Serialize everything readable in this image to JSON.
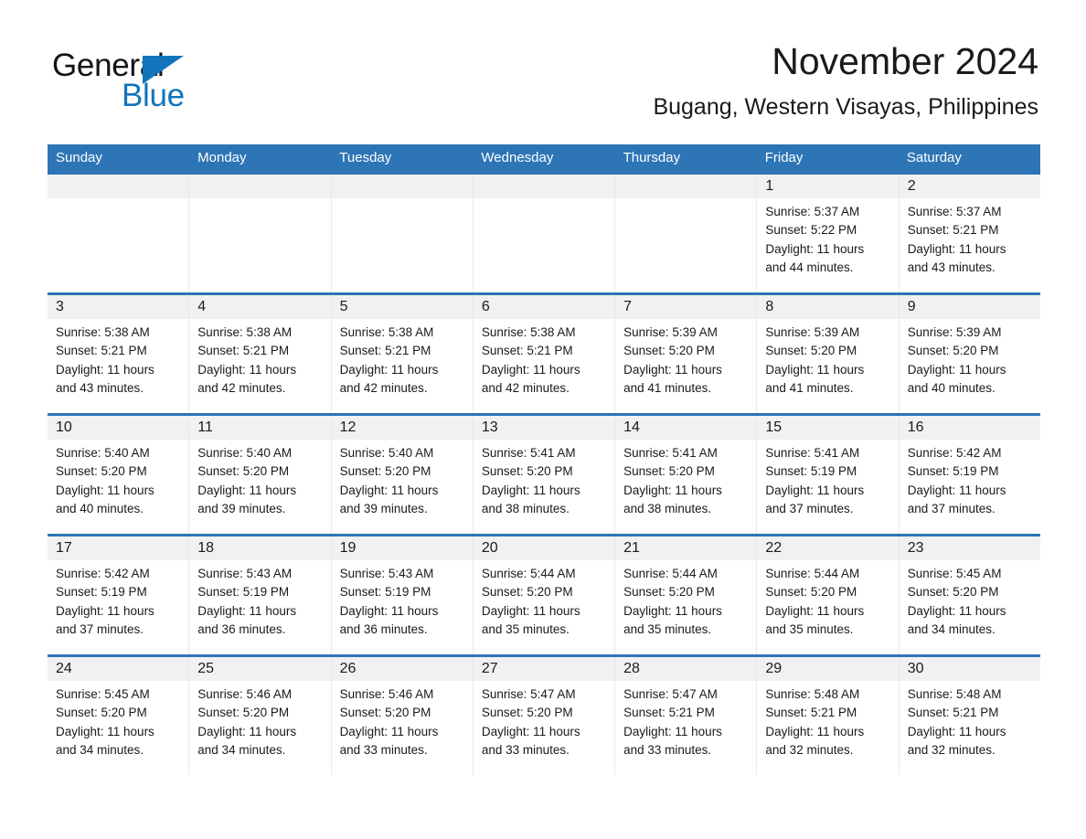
{
  "brand": {
    "name_part1": "General",
    "name_part2": "Blue",
    "triangle_icon": "triangle-icon",
    "color_black": "#141414",
    "color_blue": "#1275bc"
  },
  "header": {
    "title": "November 2024",
    "subtitle": "Bugang, Western Visayas, Philippines"
  },
  "theme": {
    "header_blue": "#2e75b6",
    "day_band_gray": "#f1f1f1",
    "text_color": "#1a1a1a"
  },
  "weekdays": [
    "Sunday",
    "Monday",
    "Tuesday",
    "Wednesday",
    "Thursday",
    "Friday",
    "Saturday"
  ],
  "weeks": [
    [
      {
        "day": "",
        "lines": []
      },
      {
        "day": "",
        "lines": []
      },
      {
        "day": "",
        "lines": []
      },
      {
        "day": "",
        "lines": []
      },
      {
        "day": "",
        "lines": []
      },
      {
        "day": "1",
        "lines": [
          "Sunrise: 5:37 AM",
          "Sunset: 5:22 PM",
          "Daylight: 11 hours",
          "and 44 minutes."
        ]
      },
      {
        "day": "2",
        "lines": [
          "Sunrise: 5:37 AM",
          "Sunset: 5:21 PM",
          "Daylight: 11 hours",
          "and 43 minutes."
        ]
      }
    ],
    [
      {
        "day": "3",
        "lines": [
          "Sunrise: 5:38 AM",
          "Sunset: 5:21 PM",
          "Daylight: 11 hours",
          "and 43 minutes."
        ]
      },
      {
        "day": "4",
        "lines": [
          "Sunrise: 5:38 AM",
          "Sunset: 5:21 PM",
          "Daylight: 11 hours",
          "and 42 minutes."
        ]
      },
      {
        "day": "5",
        "lines": [
          "Sunrise: 5:38 AM",
          "Sunset: 5:21 PM",
          "Daylight: 11 hours",
          "and 42 minutes."
        ]
      },
      {
        "day": "6",
        "lines": [
          "Sunrise: 5:38 AM",
          "Sunset: 5:21 PM",
          "Daylight: 11 hours",
          "and 42 minutes."
        ]
      },
      {
        "day": "7",
        "lines": [
          "Sunrise: 5:39 AM",
          "Sunset: 5:20 PM",
          "Daylight: 11 hours",
          "and 41 minutes."
        ]
      },
      {
        "day": "8",
        "lines": [
          "Sunrise: 5:39 AM",
          "Sunset: 5:20 PM",
          "Daylight: 11 hours",
          "and 41 minutes."
        ]
      },
      {
        "day": "9",
        "lines": [
          "Sunrise: 5:39 AM",
          "Sunset: 5:20 PM",
          "Daylight: 11 hours",
          "and 40 minutes."
        ]
      }
    ],
    [
      {
        "day": "10",
        "lines": [
          "Sunrise: 5:40 AM",
          "Sunset: 5:20 PM",
          "Daylight: 11 hours",
          "and 40 minutes."
        ]
      },
      {
        "day": "11",
        "lines": [
          "Sunrise: 5:40 AM",
          "Sunset: 5:20 PM",
          "Daylight: 11 hours",
          "and 39 minutes."
        ]
      },
      {
        "day": "12",
        "lines": [
          "Sunrise: 5:40 AM",
          "Sunset: 5:20 PM",
          "Daylight: 11 hours",
          "and 39 minutes."
        ]
      },
      {
        "day": "13",
        "lines": [
          "Sunrise: 5:41 AM",
          "Sunset: 5:20 PM",
          "Daylight: 11 hours",
          "and 38 minutes."
        ]
      },
      {
        "day": "14",
        "lines": [
          "Sunrise: 5:41 AM",
          "Sunset: 5:20 PM",
          "Daylight: 11 hours",
          "and 38 minutes."
        ]
      },
      {
        "day": "15",
        "lines": [
          "Sunrise: 5:41 AM",
          "Sunset: 5:19 PM",
          "Daylight: 11 hours",
          "and 37 minutes."
        ]
      },
      {
        "day": "16",
        "lines": [
          "Sunrise: 5:42 AM",
          "Sunset: 5:19 PM",
          "Daylight: 11 hours",
          "and 37 minutes."
        ]
      }
    ],
    [
      {
        "day": "17",
        "lines": [
          "Sunrise: 5:42 AM",
          "Sunset: 5:19 PM",
          "Daylight: 11 hours",
          "and 37 minutes."
        ]
      },
      {
        "day": "18",
        "lines": [
          "Sunrise: 5:43 AM",
          "Sunset: 5:19 PM",
          "Daylight: 11 hours",
          "and 36 minutes."
        ]
      },
      {
        "day": "19",
        "lines": [
          "Sunrise: 5:43 AM",
          "Sunset: 5:19 PM",
          "Daylight: 11 hours",
          "and 36 minutes."
        ]
      },
      {
        "day": "20",
        "lines": [
          "Sunrise: 5:44 AM",
          "Sunset: 5:20 PM",
          "Daylight: 11 hours",
          "and 35 minutes."
        ]
      },
      {
        "day": "21",
        "lines": [
          "Sunrise: 5:44 AM",
          "Sunset: 5:20 PM",
          "Daylight: 11 hours",
          "and 35 minutes."
        ]
      },
      {
        "day": "22",
        "lines": [
          "Sunrise: 5:44 AM",
          "Sunset: 5:20 PM",
          "Daylight: 11 hours",
          "and 35 minutes."
        ]
      },
      {
        "day": "23",
        "lines": [
          "Sunrise: 5:45 AM",
          "Sunset: 5:20 PM",
          "Daylight: 11 hours",
          "and 34 minutes."
        ]
      }
    ],
    [
      {
        "day": "24",
        "lines": [
          "Sunrise: 5:45 AM",
          "Sunset: 5:20 PM",
          "Daylight: 11 hours",
          "and 34 minutes."
        ]
      },
      {
        "day": "25",
        "lines": [
          "Sunrise: 5:46 AM",
          "Sunset: 5:20 PM",
          "Daylight: 11 hours",
          "and 34 minutes."
        ]
      },
      {
        "day": "26",
        "lines": [
          "Sunrise: 5:46 AM",
          "Sunset: 5:20 PM",
          "Daylight: 11 hours",
          "and 33 minutes."
        ]
      },
      {
        "day": "27",
        "lines": [
          "Sunrise: 5:47 AM",
          "Sunset: 5:20 PM",
          "Daylight: 11 hours",
          "and 33 minutes."
        ]
      },
      {
        "day": "28",
        "lines": [
          "Sunrise: 5:47 AM",
          "Sunset: 5:21 PM",
          "Daylight: 11 hours",
          "and 33 minutes."
        ]
      },
      {
        "day": "29",
        "lines": [
          "Sunrise: 5:48 AM",
          "Sunset: 5:21 PM",
          "Daylight: 11 hours",
          "and 32 minutes."
        ]
      },
      {
        "day": "30",
        "lines": [
          "Sunrise: 5:48 AM",
          "Sunset: 5:21 PM",
          "Daylight: 11 hours",
          "and 32 minutes."
        ]
      }
    ]
  ]
}
